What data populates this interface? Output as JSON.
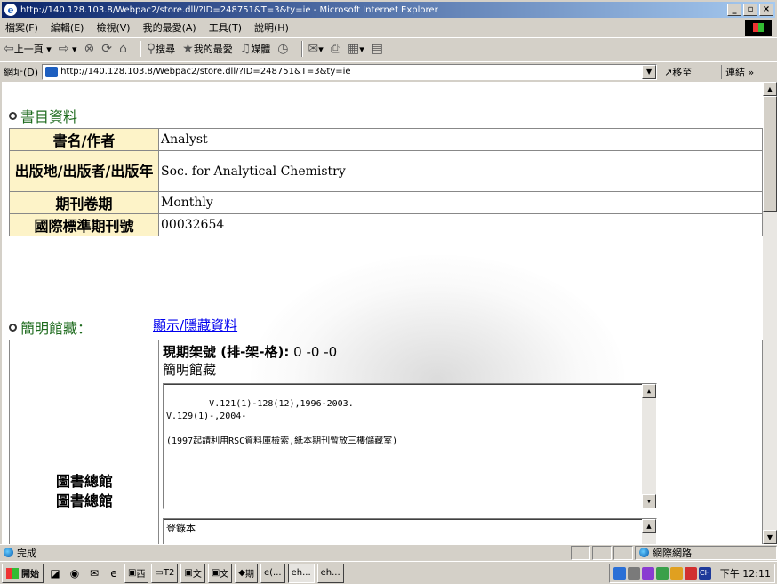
{
  "window": {
    "title": "http://140.128.103.8/Webpac2/store.dll/?ID=248751&T=3&ty=ie - Microsoft Internet Explorer"
  },
  "menu": [
    "檔案(F)",
    "編輯(E)",
    "檢視(V)",
    "我的最愛(A)",
    "工具(T)",
    "說明(H)"
  ],
  "toolbar": {
    "back": "上一頁",
    "search": "搜尋",
    "favorites": "我的最愛",
    "media": "媒體"
  },
  "address": {
    "label": "網址(D)",
    "url": "http://140.128.103.8/Webpac2/store.dll/?ID=248751&T=3&ty=ie",
    "go": "移至",
    "links": "連結"
  },
  "biblio": {
    "section_title": "書目資料",
    "rows": [
      {
        "label": "書名/作者",
        "value": "Analyst"
      },
      {
        "label": "出版地/出版者/出版年",
        "value": "Soc. for Analytical Chemistry"
      },
      {
        "label": "期刊卷期",
        "value": "Monthly"
      },
      {
        "label": "國際標準期刊號",
        "value": "00032654"
      }
    ]
  },
  "holdings": {
    "section_title": "簡明館藏：",
    "toggle_link": "顯示/隱藏資料",
    "call_label": "現期架號 (排-架-格):",
    "call_value": " 0 -0 -0",
    "label": "簡明館藏",
    "library": "圖書總館",
    "library2": "圖書總館",
    "text": "V.121(1)-128(12),1996-2003.\nV.129(1)-,2004-\n\n(1997起請利用RSC資料庫檢索,紙本期刊暫放三樓儲藏室)",
    "copy_label": "登錄本"
  },
  "status": {
    "text": "完成",
    "zone": "網際網路"
  },
  "taskbar": {
    "start": "開始",
    "buttons": [
      "西",
      "T2",
      "文",
      "文",
      "期",
      "(...",
      "h...",
      "h..."
    ],
    "clock": "下午 12:11",
    "ime": "CH"
  },
  "colors": {
    "title_gradient_start": "#0a246a",
    "section_green": "#1e6b1e",
    "label_bg": "#fdf3c8",
    "link": "#0000ee"
  }
}
